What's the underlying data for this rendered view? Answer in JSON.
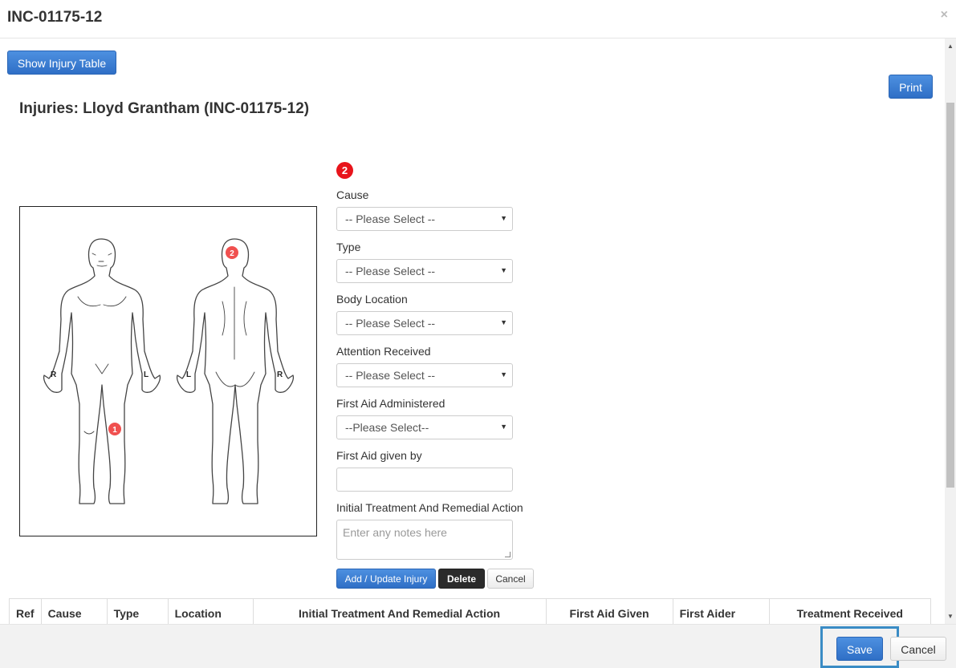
{
  "modal": {
    "title": "INC-01175-12",
    "close": "×"
  },
  "toolbar": {
    "show_injury_table": "Show Injury Table",
    "print": "Print"
  },
  "page": {
    "heading": "Injuries: Lloyd Grantham (INC-01175-12)"
  },
  "body_map": {
    "labels": {
      "front_left_hand": "R",
      "front_right_hand": "L",
      "back_left_hand": "L",
      "back_right_hand": "R"
    },
    "markers": [
      {
        "number": "1",
        "location": "front right knee"
      },
      {
        "number": "2",
        "location": "back of head"
      }
    ]
  },
  "form": {
    "current_marker": "2",
    "cause": {
      "label": "Cause",
      "value": "-- Please Select --"
    },
    "type": {
      "label": "Type",
      "value": "-- Please Select --"
    },
    "body_location": {
      "label": "Body Location",
      "value": "-- Please Select --"
    },
    "attention_received": {
      "label": "Attention Received",
      "value": "-- Please Select --"
    },
    "first_aid_administered": {
      "label": "First Aid Administered",
      "value": "--Please Select--"
    },
    "first_aid_given_by": {
      "label": "First Aid given by",
      "value": ""
    },
    "initial_treatment": {
      "label": "Initial Treatment And Remedial Action",
      "placeholder": "Enter any notes here"
    },
    "buttons": {
      "add_update": "Add / Update Injury",
      "delete": "Delete",
      "cancel": "Cancel"
    }
  },
  "table": {
    "columns": [
      "Ref",
      "Cause",
      "Type",
      "Location",
      "Initial Treatment And Remedial Action",
      "First Aid Given",
      "First Aider",
      "Treatment Received"
    ]
  },
  "footer": {
    "save": "Save",
    "cancel": "Cancel"
  },
  "colors": {
    "primary": "#337ab7",
    "marker_red": "#e8141b",
    "highlight": "#3a8cc5"
  }
}
